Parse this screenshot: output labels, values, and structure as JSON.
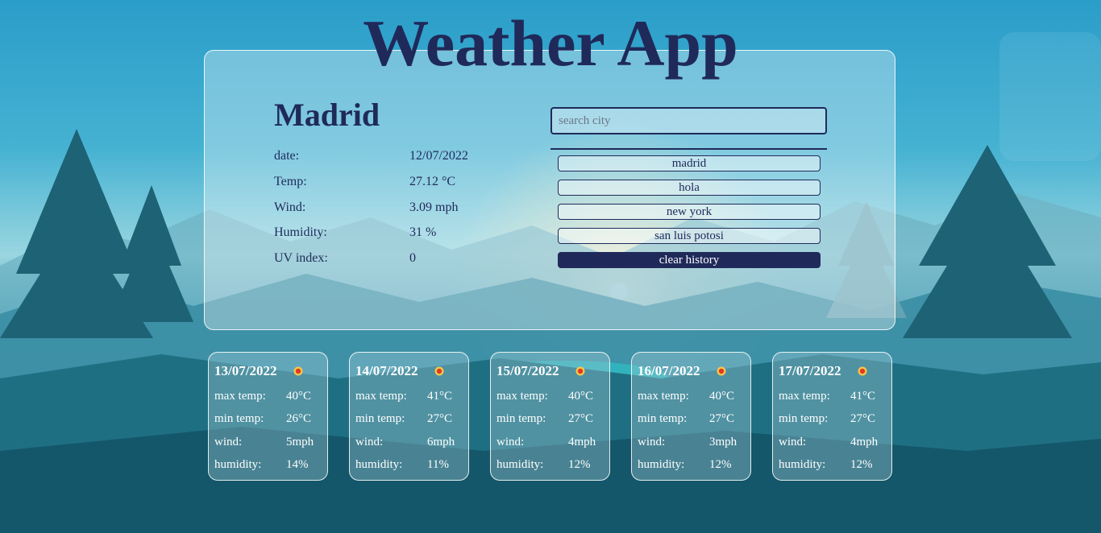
{
  "app": {
    "title": "Weather App"
  },
  "current": {
    "city": "Madrid",
    "stats": [
      {
        "label": "date:",
        "value": "12/07/2022"
      },
      {
        "label": "Temp:",
        "value": "27.12 °C"
      },
      {
        "label": "Wind:",
        "value": "3.09 mph"
      },
      {
        "label": "Humidity:",
        "value": "31 %"
      },
      {
        "label": "UV index:",
        "value": "0"
      }
    ]
  },
  "search": {
    "placeholder": "search city",
    "history": [
      "madrid",
      "hola",
      "new york",
      "san luis potosi"
    ],
    "clear_label": "clear history"
  },
  "forecast": {
    "labels": {
      "max": "max temp:",
      "min": "min temp:",
      "wind": "wind:",
      "humidity": "humidity:"
    },
    "days": [
      {
        "date": "13/07/2022",
        "max": "40°C",
        "min": "26°C",
        "wind": "5mph",
        "humidity": "14%",
        "icon": "sun-icon"
      },
      {
        "date": "14/07/2022",
        "max": "41°C",
        "min": "27°C",
        "wind": "6mph",
        "humidity": "11%",
        "icon": "sun-icon"
      },
      {
        "date": "15/07/2022",
        "max": "40°C",
        "min": "27°C",
        "wind": "4mph",
        "humidity": "12%",
        "icon": "sun-icon"
      },
      {
        "date": "16/07/2022",
        "max": "40°C",
        "min": "27°C",
        "wind": "3mph",
        "humidity": "12%",
        "icon": "sun-icon"
      },
      {
        "date": "17/07/2022",
        "max": "41°C",
        "min": "27°C",
        "wind": "4mph",
        "humidity": "12%",
        "icon": "sun-icon"
      }
    ]
  },
  "colors": {
    "primary": "#1f2a5a",
    "text_light": "#ffffff"
  }
}
